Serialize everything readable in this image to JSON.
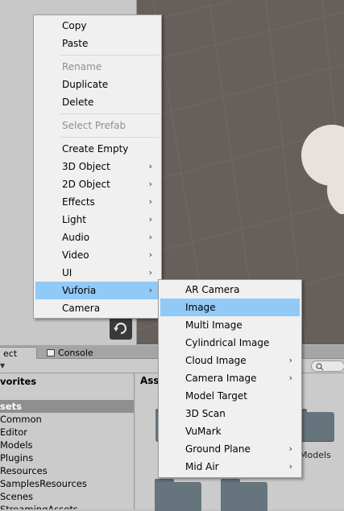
{
  "context_menu": {
    "items": [
      {
        "label": "Copy"
      },
      {
        "label": "Paste"
      },
      {
        "label": "Rename",
        "disabled": true
      },
      {
        "label": "Duplicate"
      },
      {
        "label": "Delete"
      },
      {
        "label": "Select Prefab",
        "disabled": true
      },
      {
        "label": "Create Empty"
      },
      {
        "label": "3D Object",
        "submenu": true
      },
      {
        "label": "2D Object",
        "submenu": true
      },
      {
        "label": "Effects",
        "submenu": true
      },
      {
        "label": "Light",
        "submenu": true
      },
      {
        "label": "Audio",
        "submenu": true
      },
      {
        "label": "Video",
        "submenu": true
      },
      {
        "label": "UI",
        "submenu": true
      },
      {
        "label": "Vuforia",
        "submenu": true,
        "highlighted": true
      },
      {
        "label": "Camera"
      }
    ],
    "arrow_glyph": "›"
  },
  "vuforia_submenu": {
    "items": [
      {
        "label": "AR Camera"
      },
      {
        "label": "Image",
        "highlighted": true
      },
      {
        "label": "Multi Image"
      },
      {
        "label": "Cylindrical Image"
      },
      {
        "label": "Cloud Image",
        "submenu": true
      },
      {
        "label": "Camera Image",
        "submenu": true
      },
      {
        "label": "Model Target"
      },
      {
        "label": "3D Scan"
      },
      {
        "label": "VuMark"
      },
      {
        "label": "Ground Plane",
        "submenu": true
      },
      {
        "label": "Mid Air",
        "submenu": true
      }
    ]
  },
  "bottom_panel": {
    "tabs": {
      "project": "ect",
      "console": "Console"
    },
    "tree": {
      "favorites_header": "vorites",
      "assets_header": "sets",
      "items": [
        "Common",
        "Editor",
        "Models",
        "Plugins",
        "Resources",
        "SamplesResources",
        "Scenes",
        "StreamingAssets"
      ]
    },
    "grid_header": "Ass",
    "folder_label": "Models"
  },
  "colors": {
    "menu_highlight": "#91c9f7",
    "menu_bg": "#f0f0f0",
    "scene_bg": "#665f5b",
    "panel_bg": "#cbcbcb"
  }
}
